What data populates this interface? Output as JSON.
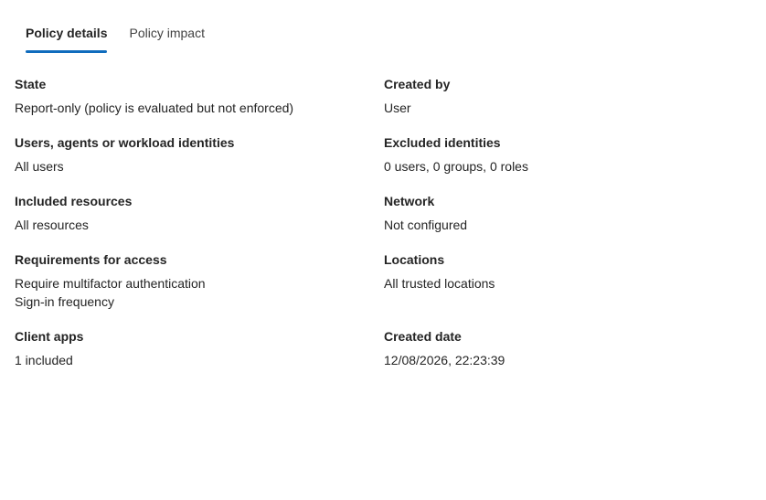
{
  "tabs": {
    "details": "Policy details",
    "impact": "Policy impact"
  },
  "fields": {
    "state": {
      "label": "State",
      "value": "Report-only (policy is evaluated but not enforced)"
    },
    "created_by": {
      "label": "Created by",
      "value": "User"
    },
    "users": {
      "label": "Users, agents or workload identities",
      "value": "All users"
    },
    "excluded": {
      "label": "Excluded identities",
      "value": "0 users, 0 groups, 0 roles"
    },
    "resources": {
      "label": "Included resources",
      "value": "All resources"
    },
    "network": {
      "label": "Network",
      "value": "Not configured"
    },
    "requirements": {
      "label": "Requirements for access",
      "values": [
        "Require multifactor authentication",
        "Sign-in frequency"
      ]
    },
    "locations": {
      "label": "Locations",
      "value": "All trusted locations"
    },
    "client_apps": {
      "label": "Client apps",
      "value": "1 included"
    },
    "created_date": {
      "label": "Created date",
      "value": "12/08/2026, 22:23:39"
    }
  },
  "colors": {
    "accent": "#0f6cbd",
    "text": "#242424"
  }
}
